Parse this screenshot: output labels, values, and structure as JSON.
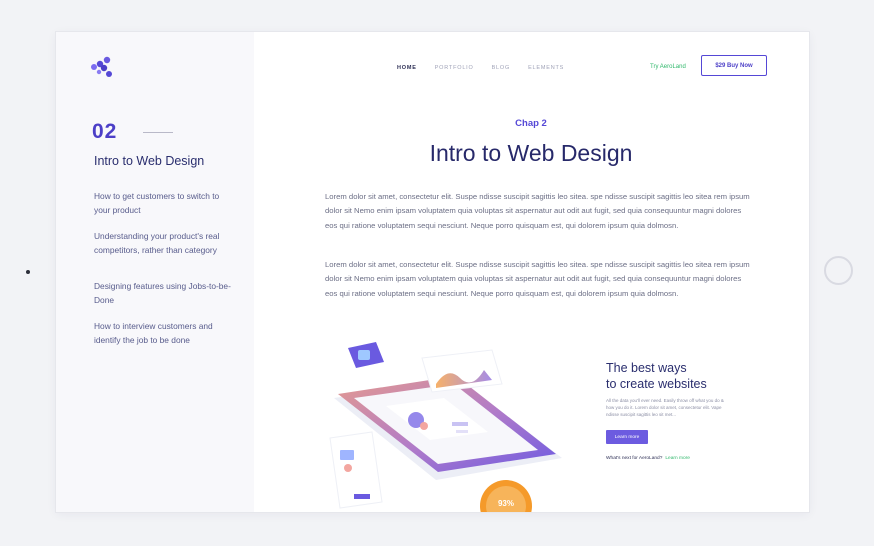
{
  "sidebar": {
    "chapter_number": "02",
    "title": "Intro to Web Design",
    "items": [
      "How to get customers to switch to your product",
      "Understanding your product's real competitors, rather than category",
      "Designing features using Jobs-to-be-Done",
      "How to interview customers and identify the job to be done"
    ]
  },
  "header": {
    "nav": [
      "HOME",
      "PORTFOLIO",
      "BLOG",
      "ELEMENTS"
    ],
    "try_label": "Try AeroLand",
    "buy_label": "$29 Buy Now"
  },
  "main": {
    "chapter_label": "Chap 2",
    "title": "Intro to Web Design",
    "paragraphs": [
      "Lorem dolor sit amet, consectetur elit. Suspe ndisse suscipit sagittis leo sitea. spe ndisse suscipit sagittis leo sitea rem ipsum dolor sit Nemo enim ipsam voluptatem quia voluptas sit aspernatur aut odit aut fugit, sed quia consequuntur magni dolores eos qui ratione voluptatem sequi nesciunt. Neque porro quisquam est, qui dolorem ipsum quia dolmosn.",
      "Lorem dolor sit amet, consectetur elit. Suspe ndisse suscipit sagittis leo sitea. spe ndisse suscipit sagittis leo sitea rem ipsum dolor sit Nemo enim ipsam voluptatem quia voluptas sit aspernatur aut odit aut fugit, sed quia consequuntur magni dolores eos qui ratione voluptatem sequi nesciunt. Neque porro quisquam est, qui dolorem ipsum quia dolmosn."
    ]
  },
  "promo": {
    "title_line1": "The best ways",
    "title_line2": "to create websites",
    "text": "All the data you'll ever need. Easily throw off what you do & how you do it. Lorem dolor sit amet, consectetur elit. Vape ndisse suscipit sagittis leo sit met...",
    "button_label": "Learn more",
    "next_label": "What's next for AeroLand?",
    "next_link": "Learn more",
    "badge": "93%"
  },
  "colors": {
    "accent": "#5548d6",
    "heading": "#27296a",
    "green": "#31b86c",
    "orange": "#f59a2a"
  }
}
